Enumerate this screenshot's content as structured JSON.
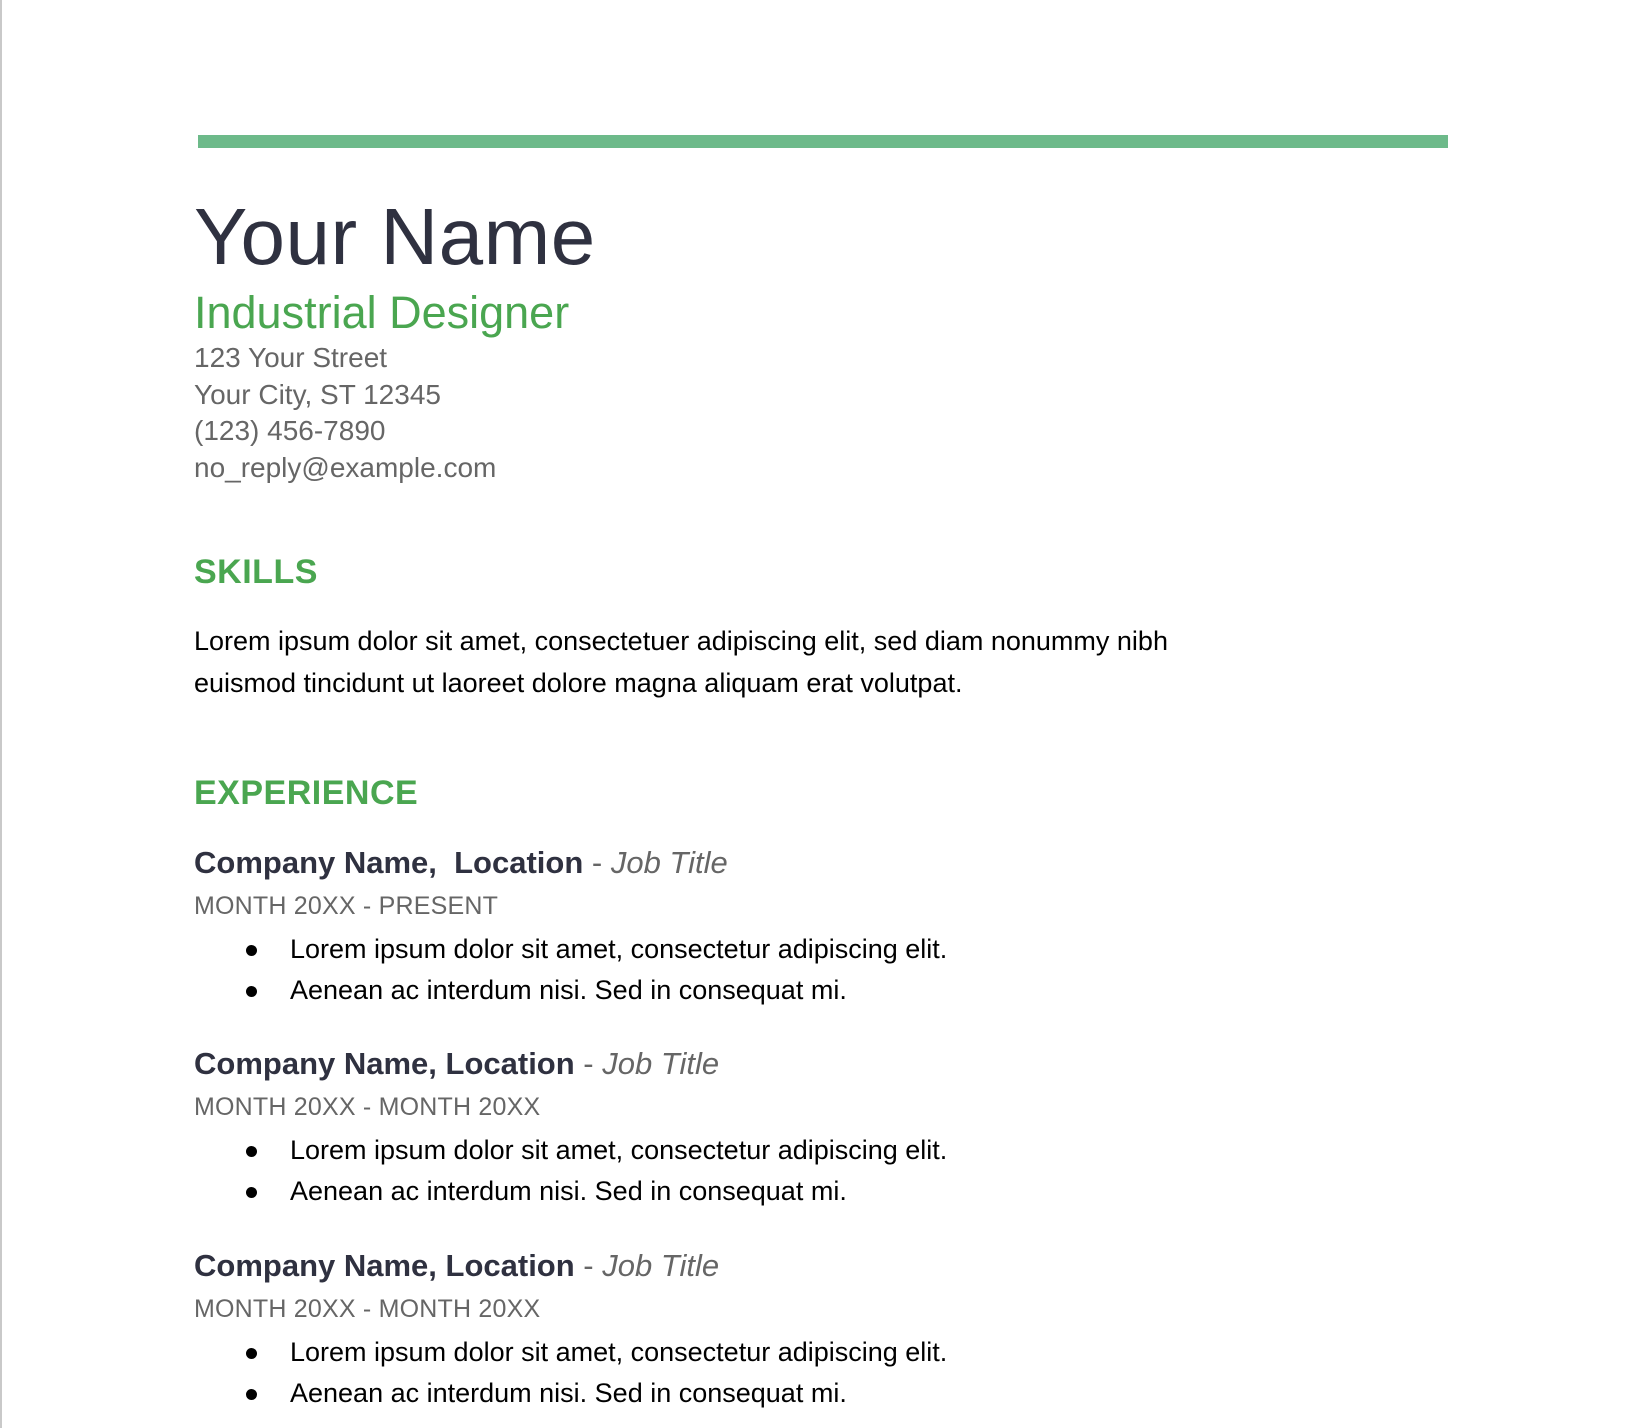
{
  "colors": {
    "accent_bar": "#6dba8a",
    "heading_green": "#4aa650",
    "name_text": "#2f3140",
    "muted_text": "#666666",
    "body_text": "#000000"
  },
  "header": {
    "name": "Your Name",
    "profession": "Industrial Designer",
    "contact": {
      "street": "123 Your Street",
      "city_state_zip": "Your City, ST 12345",
      "phone": "(123) 456-7890",
      "email": "no_reply@example.com"
    }
  },
  "skills": {
    "heading": "SKILLS",
    "text": "Lorem ipsum dolor sit amet, consectetuer adipiscing elit, sed diam nonummy nibh euismod tincidunt ut laoreet dolore magna aliquam erat volutpat."
  },
  "experience": {
    "heading": "EXPERIENCE",
    "jobs": [
      {
        "company_location": "Company Name,  Location",
        "separator": " - ",
        "title": "Job Title",
        "dates": "MONTH 20XX - PRESENT",
        "bullets": [
          "Lorem ipsum dolor sit amet, consectetur adipiscing elit.",
          "Aenean ac interdum nisi. Sed in consequat mi."
        ]
      },
      {
        "company_location": "Company Name, Location",
        "separator": " - ",
        "title": "Job Title",
        "dates": "MONTH 20XX - MONTH 20XX",
        "bullets": [
          "Lorem ipsum dolor sit amet, consectetur adipiscing elit.",
          "Aenean ac interdum nisi. Sed in consequat mi."
        ]
      },
      {
        "company_location": "Company Name, Location",
        "separator": " - ",
        "title": "Job Title",
        "dates": "MONTH 20XX - MONTH 20XX",
        "bullets": [
          "Lorem ipsum dolor sit amet, consectetur adipiscing elit.",
          "Aenean ac interdum nisi. Sed in consequat mi."
        ]
      }
    ]
  }
}
